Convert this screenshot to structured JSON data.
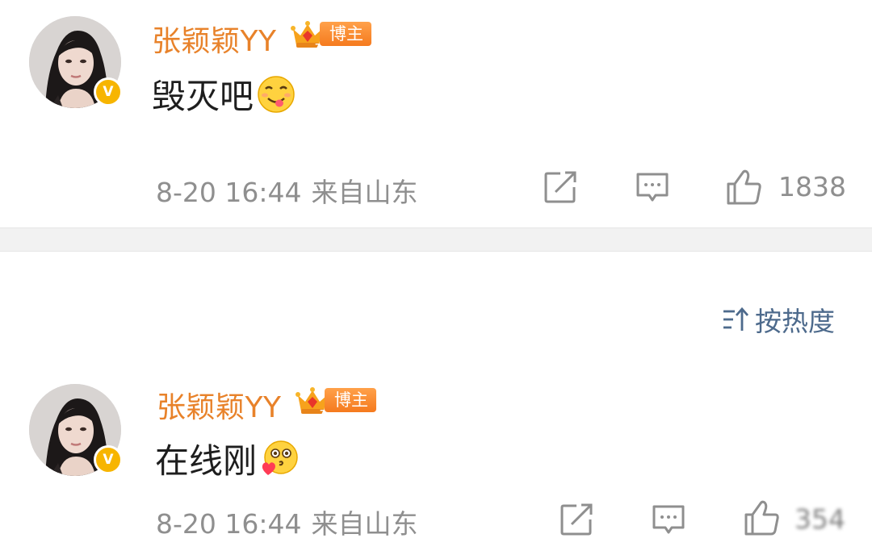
{
  "comments": [
    {
      "username": "张颖颖YY",
      "badge": "博主",
      "text": "毁灭吧",
      "emoji": "drooling-emoji",
      "time": "8-20 16:44",
      "location": "来自山东",
      "likes": "1838"
    },
    {
      "username": "张颖颖YY",
      "badge": "博主",
      "text": "在线刚",
      "emoji": "heart-kiss-emoji",
      "time": "8-20 16:44",
      "location": "来自山东",
      "likes": "354"
    }
  ],
  "sort": {
    "label": "按热度",
    "icon": "sort-icon"
  },
  "colors": {
    "username": "#e8822a",
    "badge": "#f57a1e",
    "verified": "#f7b500",
    "meta": "#8f8f8f",
    "sort": "#4d6a8c",
    "divider": "#f2f2f2"
  },
  "icons": [
    "share-icon",
    "comment-icon",
    "like-icon",
    "verified-icon",
    "crown-icon"
  ]
}
